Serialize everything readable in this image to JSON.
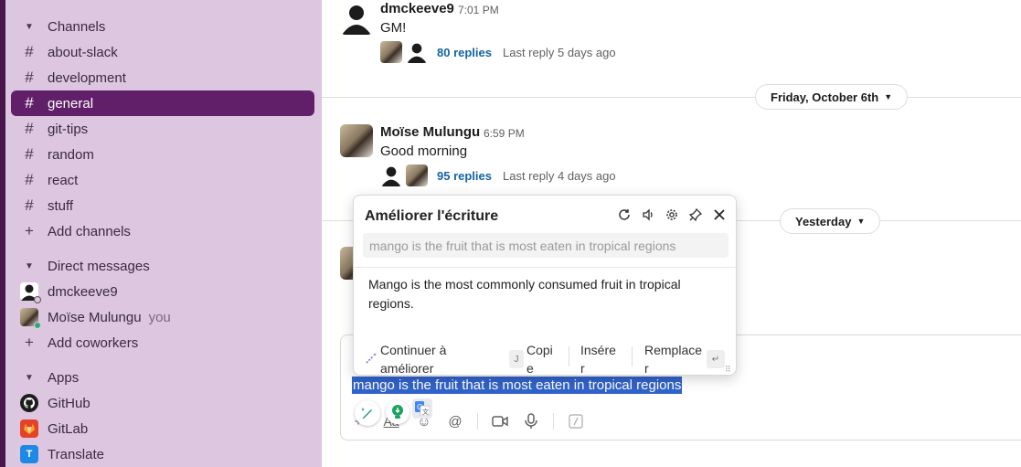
{
  "sidebar": {
    "channels_header": "Channels",
    "channels": [
      {
        "label": "about-slack"
      },
      {
        "label": "development"
      },
      {
        "label": "general"
      },
      {
        "label": "git-tips"
      },
      {
        "label": "random"
      },
      {
        "label": "react"
      },
      {
        "label": "stuff"
      }
    ],
    "active_channel": "general",
    "add_channels": "Add channels",
    "dm_header": "Direct messages",
    "dms": [
      {
        "label": "dmckeeve9",
        "suffix": ""
      },
      {
        "label": "Moïse Mulungu",
        "suffix": "you"
      }
    ],
    "add_coworkers": "Add coworkers",
    "apps_header": "Apps",
    "apps": [
      {
        "label": "GitHub",
        "icon": "github-icon"
      },
      {
        "label": "GitLab",
        "icon": "gitlab-icon"
      },
      {
        "label": "Translate",
        "icon": "translate-icon"
      }
    ],
    "colors": {
      "bg": "#dcc6e0",
      "active": "#611f69"
    }
  },
  "messages": [
    {
      "author": "dmckeeve9",
      "time": "7:01 PM",
      "text": "GM!",
      "replies": "80 replies",
      "last_reply": "Last reply 5 days ago"
    },
    {
      "author": "Moïse Mulungu",
      "time": "6:59 PM",
      "text": "Good morning",
      "replies": "95 replies",
      "last_reply": "Last reply 4 days ago"
    }
  ],
  "dividers": {
    "first": "Friday, October 6th",
    "second": "Yesterday"
  },
  "composer": {
    "selected_text": "mango is the fruit that is most eaten in tropical regions",
    "format_label": "Aa"
  },
  "popup": {
    "title": "Améliorer l'écriture",
    "original": "mango is the fruit that is most eaten in tropical regions",
    "result": "Mango is the most commonly consumed fruit in tropical regions.",
    "actions": {
      "continue_line1": "Continuer à",
      "continue_line2": "améliorer",
      "copy_line1": "Copi",
      "copy_line2": "e",
      "insert_line1": "Insére",
      "insert_line2": "r",
      "replace_line1": "Remplace",
      "replace_line2": "r"
    },
    "kbd_copy": "J",
    "kbd_replace": "↵"
  },
  "colors": {
    "link": "#1264a3",
    "selection": "#3163c9"
  }
}
